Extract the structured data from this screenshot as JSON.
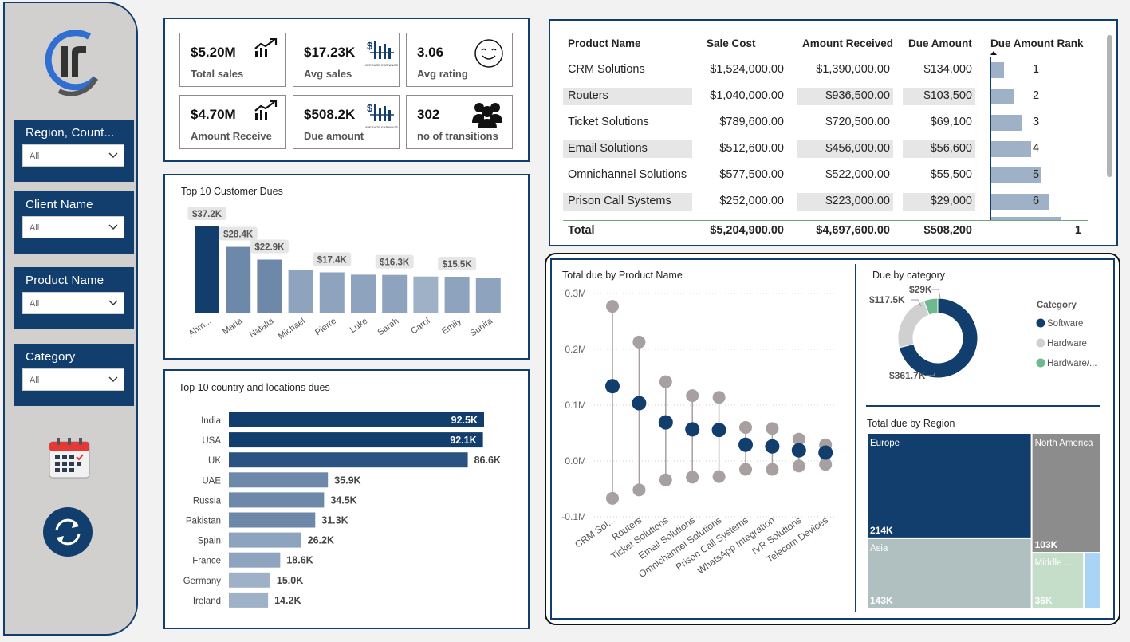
{
  "filters": [
    {
      "title": "Region, Count...",
      "value": "All"
    },
    {
      "title": "Client Name",
      "value": "All"
    },
    {
      "title": "Product Name",
      "value": "All"
    },
    {
      "title": "Category",
      "value": "All"
    }
  ],
  "kpis": [
    {
      "value": "$5.20M",
      "label": "Total sales",
      "icon": "trend-up-icon"
    },
    {
      "value": "$17.23K",
      "label": "Avg sales",
      "icon": "average-earnings-icon",
      "icon_caption": "AVERAGE EARNINGS"
    },
    {
      "value": "3.06",
      "label": "Avg rating",
      "icon": "smiley-icon"
    },
    {
      "value": "$4.70M",
      "label": "Amount Receive",
      "icon": "trend-up-icon"
    },
    {
      "value": "$508.2K",
      "label": "Due amount",
      "icon": "average-earnings-icon",
      "icon_caption": "AVERAGE EARNINGS"
    },
    {
      "value": "302",
      "label": "no of transitions",
      "icon": "people-icon"
    }
  ],
  "product_table": {
    "headers": [
      "Product Name",
      "Sale Cost",
      "Amount Received",
      "Due Amount",
      "Due Amount Rank"
    ],
    "rows": [
      {
        "name": "CRM Solutions",
        "sale_cost": "$1,524,000.00",
        "received": "$1,390,000.00",
        "due": "$134,000",
        "rank": "1",
        "rank_bar": 0.21
      },
      {
        "name": "Routers",
        "sale_cost": "$1,040,000.00",
        "received": "$936,500.00",
        "due": "$103,500",
        "rank": "2",
        "rank_bar": 0.36
      },
      {
        "name": "Ticket Solutions",
        "sale_cost": "$789,600.00",
        "received": "$720,500.00",
        "due": "$69,100",
        "rank": "3",
        "rank_bar": 0.5
      },
      {
        "name": "Email Solutions",
        "sale_cost": "$512,600.00",
        "received": "$456,000.00",
        "due": "$56,600",
        "rank": "4",
        "rank_bar": 0.64
      },
      {
        "name": "Omnichannel Solutions",
        "sale_cost": "$577,500.00",
        "received": "$522,000.00",
        "due": "$55,500",
        "rank": "5",
        "rank_bar": 0.79
      },
      {
        "name": "Prison Call Systems",
        "sale_cost": "$252,000.00",
        "received": "$223,000.00",
        "due": "$29,000",
        "rank": "6",
        "rank_bar": 0.93
      }
    ],
    "total": {
      "label": "Total",
      "sale_cost": "$5,204,900.00",
      "received": "$4,697,600.00",
      "due": "$508,200",
      "rank": "1"
    }
  },
  "chart_data": [
    {
      "type": "bar",
      "title": "Top 10 Customer Dues",
      "categories": [
        "Ahm...",
        "Maria",
        "Natalia",
        "Michael",
        "Pierre",
        "Luke",
        "Sarah",
        "Carol",
        "Emily",
        "Sunita"
      ],
      "values": [
        37.2,
        28.4,
        22.9,
        18.5,
        17.4,
        16.4,
        16.3,
        15.6,
        15.5,
        15.1
      ],
      "data_labels": [
        "$37.2K",
        "$28.4K",
        "$22.9K",
        "",
        "$17.4K",
        "",
        "$16.3K",
        "",
        "$15.5K",
        ""
      ],
      "colors": [
        "#123e6e",
        "#6d88a8",
        "#6d88a8",
        "#8ea3bd",
        "#8ea3bd",
        "#8ea3bd",
        "#8ea3bd",
        "#9fb1c7",
        "#8ea3bd",
        "#8ea3bd"
      ]
    },
    {
      "type": "bar",
      "orientation": "horizontal",
      "title": "Top 10 country and locations dues",
      "categories": [
        "India",
        "USA",
        "UK",
        "UAE",
        "Russia",
        "Pakistan",
        "Spain",
        "France",
        "Germany",
        "Ireland"
      ],
      "values": [
        92.5,
        92.1,
        86.6,
        35.9,
        34.5,
        31.3,
        26.2,
        18.6,
        15.0,
        14.2
      ],
      "data_labels": [
        "92.5K",
        "92.1K",
        "86.6K",
        "35.9K",
        "34.5K",
        "31.3K",
        "26.2K",
        "18.6K",
        "15.0K",
        "14.2K"
      ],
      "colors": [
        "#123e6e",
        "#123e6e",
        "#2b5382",
        "#6d88a8",
        "#6d88a8",
        "#6d88a8",
        "#8ea3bd",
        "#8ea3bd",
        "#9fb1c7",
        "#9fb1c7"
      ]
    },
    {
      "type": "scatter",
      "subtype": "dumbbell",
      "title": "Total due by Product Name",
      "categories": [
        "CRM Sol...",
        "Routers",
        "Ticket Solutions",
        "Email Solutions",
        "Omnichannel Solutions",
        "Prison Call Systems",
        "WhatsApp Integration",
        "IVR Solutions",
        "Telecom Devices"
      ],
      "series": [
        {
          "values": [
            0.277,
            0.213,
            0.142,
            0.117,
            0.114,
            0.06,
            0.058,
            0.039,
            0.029
          ]
        },
        {
          "values": [
            0.134,
            0.1035,
            0.0691,
            0.0566,
            0.0555,
            0.029,
            0.026,
            0.019,
            0.015
          ]
        },
        {
          "values": [
            -0.067,
            -0.052,
            -0.034,
            -0.029,
            -0.028,
            -0.015,
            -0.015,
            -0.009,
            -0.006
          ]
        }
      ],
      "colors": [
        "#a8a0a0",
        "#123e6e",
        "#a8a0a0"
      ],
      "ylim": [
        -0.1,
        0.3
      ],
      "yticks": [
        "0.3M",
        "0.2M",
        "0.1M",
        "0.0M",
        "-0.1M"
      ],
      "grid": true
    },
    {
      "type": "pie",
      "subtype": "donut",
      "title": "Due by category",
      "legend_title": "Category",
      "labels": [
        "Software",
        "Hardware",
        "Hardware/..."
      ],
      "values": [
        361.7,
        117.5,
        29
      ],
      "data_labels": [
        "$361.7K",
        "$117.5K",
        "$29K"
      ],
      "colors": [
        "#123e6e",
        "#d0d0d0",
        "#6fb98f"
      ],
      "legend_position": "right"
    },
    {
      "type": "heatmap",
      "subtype": "treemap",
      "title": "Total due by Region",
      "labels": [
        "Europe",
        "North America",
        "Asia",
        "Middle ...",
        ""
      ],
      "values": [
        214,
        103,
        143,
        36,
        12
      ],
      "data_labels": [
        "214K",
        "103K",
        "143K",
        "36K",
        ""
      ],
      "colors": [
        "#123e6e",
        "#8c8c8c",
        "#b0bfbf",
        "#c4dec9",
        "#a9d4f5"
      ]
    }
  ]
}
